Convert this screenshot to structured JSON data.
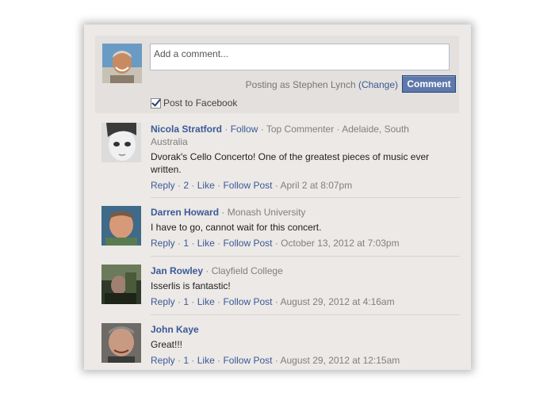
{
  "composer": {
    "placeholder": "Add a comment...",
    "posting_as_prefix": "Posting as Stephen Lynch",
    "change_label": "(Change)",
    "comment_button": "Comment",
    "post_to_facebook_label": "Post to Facebook",
    "post_to_facebook_checked": true
  },
  "comments": [
    {
      "name": "Nicola Stratford",
      "follow_label": "Follow",
      "affiliation": "Top Commenter · Adelaide, South Australia",
      "text": "Dvorak's Cello Concerto! One of the greatest pieces of music ever written.",
      "reply_label": "Reply",
      "like_count": "2",
      "like_label": "Like",
      "follow_post_label": "Follow Post",
      "timestamp": "April 2 at 8:07pm"
    },
    {
      "name": "Darren Howard",
      "affiliation": "Monash University",
      "text": "I have to go, cannot wait for this concert.",
      "reply_label": "Reply",
      "like_count": "1",
      "like_label": "Like",
      "follow_post_label": "Follow Post",
      "timestamp": "October 13, 2012 at 7:03pm"
    },
    {
      "name": "Jan Rowley",
      "affiliation": "Clayfield College",
      "text": "Isserlis is fantastic!",
      "reply_label": "Reply",
      "like_count": "1",
      "like_label": "Like",
      "follow_post_label": "Follow Post",
      "timestamp": "August 29, 2012 at 4:16am"
    },
    {
      "name": "John Kaye",
      "text": "Great!!!",
      "reply_label": "Reply",
      "like_count": "1",
      "like_label": "Like",
      "follow_post_label": "Follow Post",
      "timestamp": "August 29, 2012 at 12:15am"
    }
  ],
  "colors": {
    "link": "#3b5998",
    "button": "#5f78ab",
    "panel": "#ece9e6"
  }
}
